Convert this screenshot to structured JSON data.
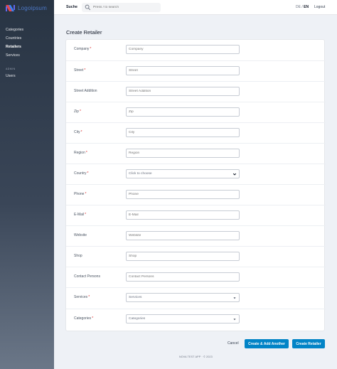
{
  "app": {
    "logo_text": "Logoipsum",
    "accent_color": "#0284c7"
  },
  "sidebar": {
    "items": [
      {
        "label": "Categories",
        "active": false
      },
      {
        "label": "Countries",
        "active": false
      },
      {
        "label": "Retailers",
        "active": true
      },
      {
        "label": "Services",
        "active": false
      }
    ],
    "section_heading": "ADMIN",
    "admin_items": [
      {
        "label": "Users",
        "active": false
      }
    ]
  },
  "topbar": {
    "search_label": "Suche",
    "search_placeholder": "Press / to search",
    "lang_de": "DE",
    "lang_sep": " / ",
    "lang_en": "EN",
    "logout_label": "Logout"
  },
  "page": {
    "title": "Create Retailer"
  },
  "form": {
    "fields": [
      {
        "label": "Company",
        "required": true,
        "placeholder": "Company",
        "type": "text"
      },
      {
        "label": "Street",
        "required": true,
        "placeholder": "Street",
        "type": "text"
      },
      {
        "label": "Street Addition",
        "required": false,
        "placeholder": "Street Addition",
        "type": "text"
      },
      {
        "label": "Zip",
        "required": true,
        "placeholder": "Zip",
        "type": "text"
      },
      {
        "label": "City",
        "required": true,
        "placeholder": "City",
        "type": "text"
      },
      {
        "label": "Region",
        "required": true,
        "placeholder": "Region",
        "type": "text"
      },
      {
        "label": "Country",
        "required": true,
        "placeholder": "Click to choose",
        "type": "select"
      },
      {
        "label": "Phone",
        "required": true,
        "placeholder": "Phone",
        "type": "text"
      },
      {
        "label": "E-Mail",
        "required": true,
        "placeholder": "E-Mail",
        "type": "text"
      },
      {
        "label": "Website",
        "required": false,
        "placeholder": "Website",
        "type": "text"
      },
      {
        "label": "Shop",
        "required": false,
        "placeholder": "Shop",
        "type": "text"
      },
      {
        "label": "Contact Persons",
        "required": false,
        "placeholder": "Contact Persons",
        "type": "text"
      },
      {
        "label": "Services",
        "required": true,
        "placeholder": "Services",
        "type": "multiselect"
      },
      {
        "label": "Categories",
        "required": true,
        "placeholder": "Categories",
        "type": "multiselect"
      }
    ],
    "required_marker": "*"
  },
  "actions": {
    "cancel": "Cancel",
    "create_add_another": "Create & Add Another",
    "create": "Create Retailer"
  },
  "footer": {
    "text": "NOVA TEST APP · © 2023"
  }
}
